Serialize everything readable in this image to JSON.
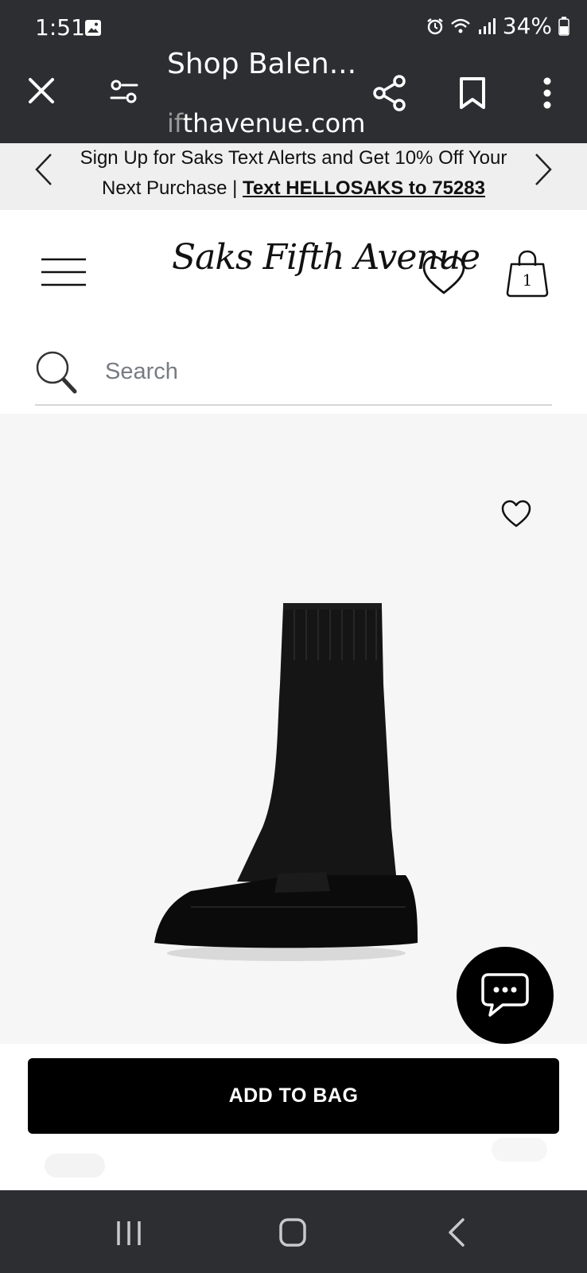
{
  "status_bar": {
    "time": "1:51",
    "battery": "34%",
    "icons": [
      "gallery-icon",
      "alarm-icon",
      "wifi-icon",
      "signal-icon",
      "battery-icon"
    ]
  },
  "toolbar": {
    "title": "Shop Balen...",
    "url_faded": "if",
    "url": "thavenue.com",
    "icons": [
      "close-icon",
      "page-settings-icon",
      "share-icon",
      "bookmark-icon",
      "more-vert-icon"
    ]
  },
  "promo": {
    "line1": "Sign Up for Saks Text Alerts and Get 10% Off Your",
    "line2_prefix": "Next Purchase | ",
    "line2_link": "Text HELLOSAKS to 75283"
  },
  "header": {
    "logo": "Saks Fifth Avenue",
    "bag_count": "1"
  },
  "search": {
    "placeholder": "Search"
  },
  "product": {
    "image": "black-sock-sneaker",
    "add_to_bag": "ADD TO BAG"
  },
  "colors": {
    "chrome": "#2d2e32",
    "promo_bg": "#efefef",
    "product_bg": "#f6f6f6",
    "button_bg": "#000000",
    "text": "#111111"
  }
}
